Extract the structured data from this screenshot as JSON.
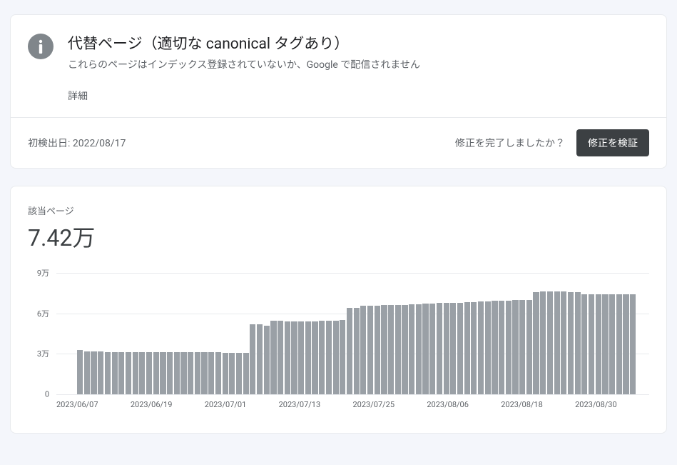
{
  "header": {
    "title": "代替ページ（適切な canonical タグあり）",
    "subtitle": "これらのページはインデックス登録されていないか、Google で配信されません",
    "details_link": "詳細"
  },
  "footer": {
    "first_detected_label": "初検出日: ",
    "first_detected_date": "2022/08/17",
    "prompt": "修正を完了しましたか？",
    "validate_button": "修正を検証"
  },
  "chart": {
    "label": "該当ページ",
    "value_display": "7.42万"
  },
  "chart_data": {
    "type": "bar",
    "title": "該当ページ",
    "ylabel": "",
    "xlabel": "",
    "ylim": [
      0,
      9
    ],
    "y_unit": "万",
    "y_ticks": [
      0,
      3,
      6,
      9
    ],
    "y_tick_labels": [
      "0",
      "3万",
      "6万",
      "9万"
    ],
    "x_tick_labels": [
      "2023/06/07",
      "2023/06/19",
      "2023/07/01",
      "2023/07/13",
      "2023/07/25",
      "2023/08/06",
      "2023/08/18",
      "2023/08/30"
    ],
    "values": [
      null,
      null,
      null,
      3.3,
      3.2,
      3.2,
      3.2,
      3.15,
      3.15,
      3.15,
      3.15,
      3.15,
      3.15,
      3.15,
      3.15,
      3.1,
      3.1,
      3.1,
      3.1,
      3.1,
      3.1,
      3.1,
      3.1,
      3.1,
      3.05,
      3.05,
      3.05,
      3.05,
      5.2,
      5.2,
      5.1,
      5.45,
      5.45,
      5.4,
      5.4,
      5.4,
      5.4,
      5.4,
      5.45,
      5.45,
      5.45,
      5.5,
      6.4,
      6.4,
      6.55,
      6.55,
      6.55,
      6.6,
      6.6,
      6.6,
      6.6,
      6.65,
      6.65,
      6.7,
      6.7,
      6.8,
      6.8,
      6.8,
      6.8,
      6.85,
      6.85,
      6.9,
      6.9,
      6.95,
      6.95,
      6.95,
      6.98,
      6.98,
      7.0,
      7.55,
      7.6,
      7.6,
      7.6,
      7.6,
      7.58,
      7.55,
      7.42,
      7.42,
      7.42,
      7.4,
      7.4,
      7.4,
      7.4,
      7.4,
      null,
      null
    ]
  }
}
